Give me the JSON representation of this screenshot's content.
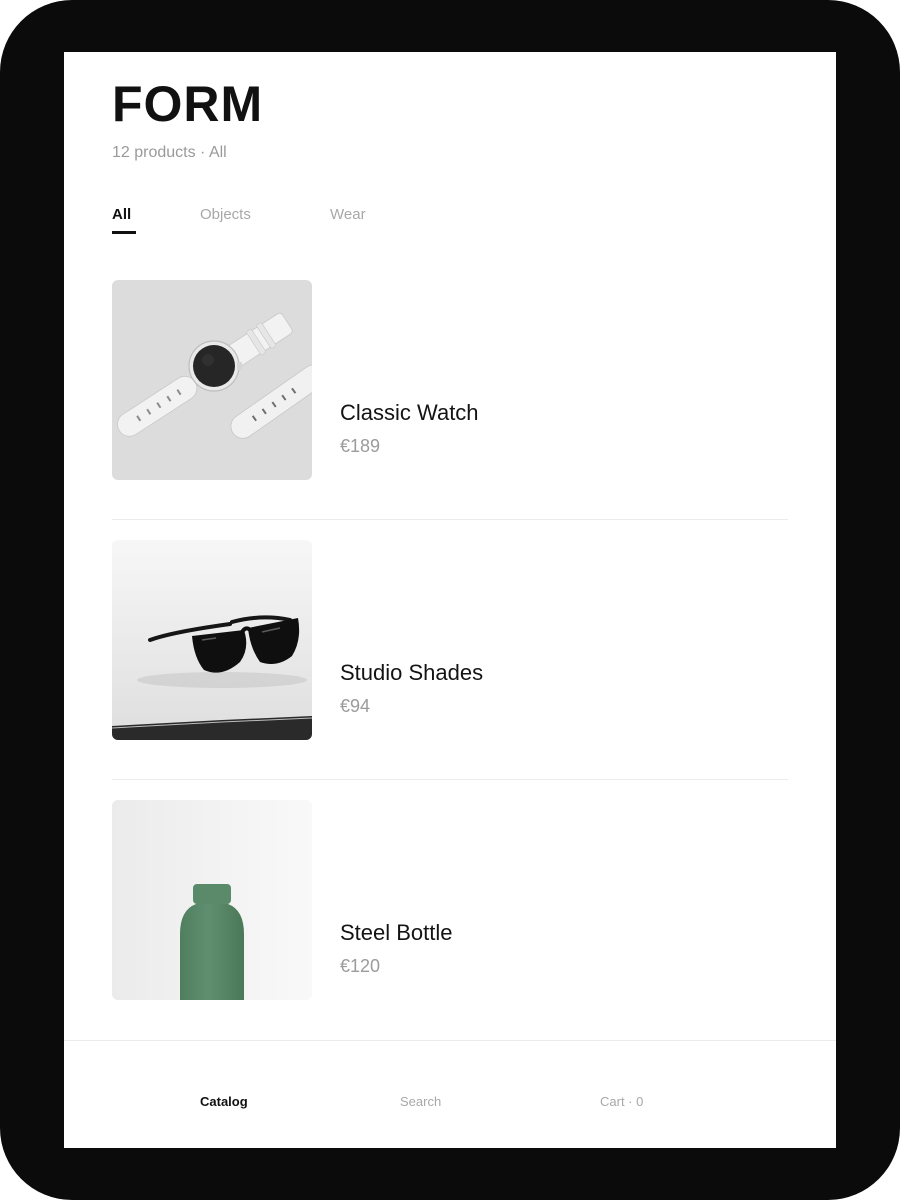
{
  "header": {
    "brand": "FORM",
    "subtitle": "12 products · All"
  },
  "tabs": [
    {
      "label": "All",
      "active": true
    },
    {
      "label": "Objects",
      "active": false
    },
    {
      "label": "Wear",
      "active": false
    }
  ],
  "products": [
    {
      "name": "Classic Watch",
      "price": "€189",
      "image": "white-wristwatch"
    },
    {
      "name": "Studio Shades",
      "price": "€94",
      "image": "black-sunglasses"
    },
    {
      "name": "Steel Bottle",
      "price": "€120",
      "image": "green-bottle"
    }
  ],
  "bottom_nav": {
    "catalog": "Catalog",
    "search": "Search",
    "cart": "Cart · 0",
    "active": "catalog"
  },
  "colors": {
    "frame": "#0b0b0b",
    "text_primary": "#111111",
    "text_muted": "#9a9a9a",
    "bottle_green": "#5a8a6a"
  }
}
